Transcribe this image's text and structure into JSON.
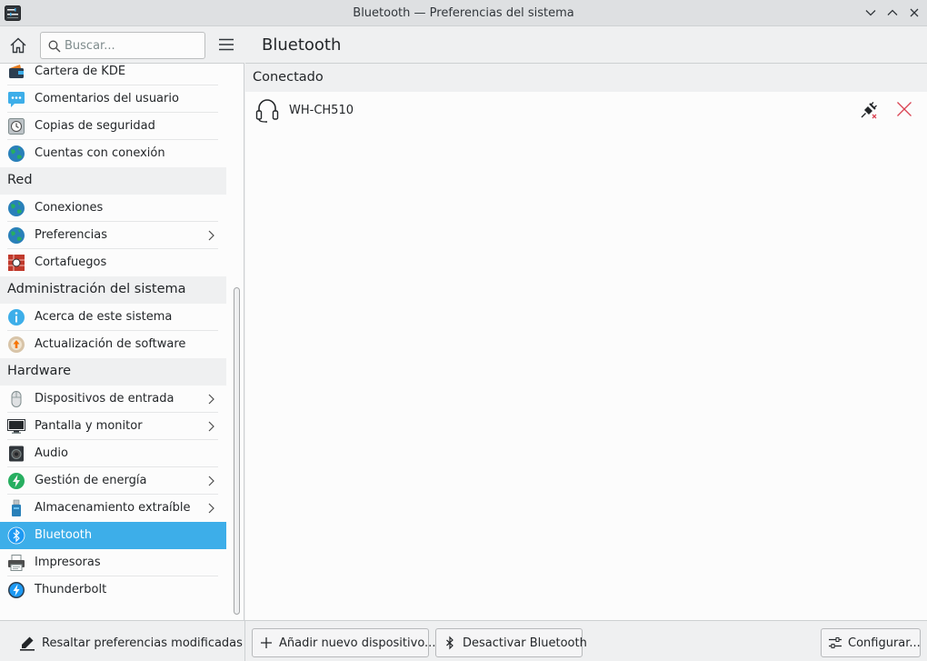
{
  "window": {
    "title": "Bluetooth — Preferencias del sistema"
  },
  "search": {
    "placeholder": "Buscar..."
  },
  "sidebar": {
    "items": [
      {
        "label": "Cartera de KDE",
        "icon": "kde-wallet-icon"
      },
      {
        "label": "Comentarios del usuario",
        "icon": "user-feedback-icon"
      },
      {
        "label": "Copias de seguridad",
        "icon": "backup-icon"
      },
      {
        "label": "Cuentas con conexión",
        "icon": "online-accounts-icon"
      },
      {
        "section": "Red"
      },
      {
        "label": "Conexiones",
        "icon": "network-globe-icon"
      },
      {
        "label": "Preferencias",
        "icon": "network-globe-icon",
        "chevron": true
      },
      {
        "label": "Cortafuegos",
        "icon": "firewall-icon"
      },
      {
        "section": "Administración del sistema"
      },
      {
        "label": "Acerca de este sistema",
        "icon": "info-icon"
      },
      {
        "label": "Actualización de software",
        "icon": "software-update-icon"
      },
      {
        "section": "Hardware"
      },
      {
        "label": "Dispositivos de entrada",
        "icon": "mouse-icon",
        "chevron": true
      },
      {
        "label": "Pantalla y monitor",
        "icon": "monitor-icon",
        "chevron": true
      },
      {
        "label": "Audio",
        "icon": "speaker-icon"
      },
      {
        "label": "Gestión de energía",
        "icon": "power-management-icon",
        "chevron": true
      },
      {
        "label": "Almacenamiento extraíble",
        "icon": "usb-drive-icon",
        "chevron": true
      },
      {
        "label": "Bluetooth",
        "icon": "bluetooth-icon",
        "selected": true
      },
      {
        "label": "Impresoras",
        "icon": "printer-icon"
      },
      {
        "label": "Thunderbolt",
        "icon": "thunderbolt-icon"
      }
    ]
  },
  "main": {
    "title": "Bluetooth",
    "group_label": "Conectado",
    "devices": [
      {
        "name": "WH-CH510",
        "icon": "headset-icon"
      }
    ]
  },
  "bottom": {
    "highlight_label": "Resaltar preferencias modificadas",
    "add_device_label": "Añadir nuevo dispositivo...",
    "disable_bt_label": "Desactivar Bluetooth",
    "configure_label": "Configurar..."
  },
  "colors": {
    "accent": "#3daee9",
    "remove": "#da4453"
  }
}
